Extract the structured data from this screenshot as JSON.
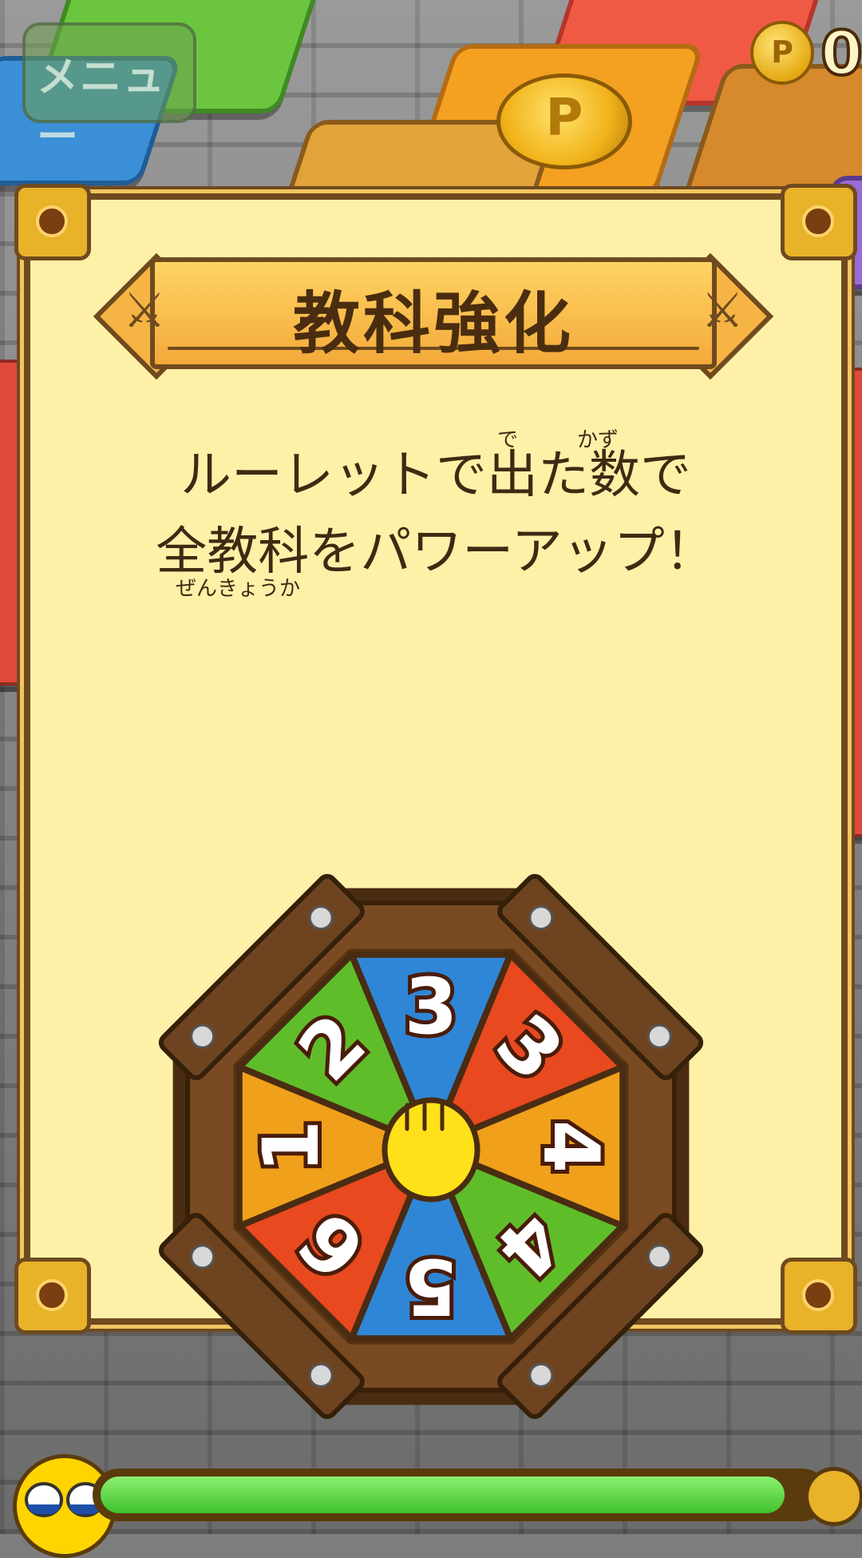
{
  "topbar": {
    "menu_label": "メニュー",
    "points_value": "0",
    "coin_icon_label": "P"
  },
  "board": {
    "big_coin_label": "P"
  },
  "dialog": {
    "title": "教科強化",
    "line1": "ルーレットで出た数で",
    "line2": "全教科をパワーアップ！",
    "ruby_de": "で",
    "ruby_kazu": "かず",
    "ruby_zenkyouka": "ぜんきょうか"
  },
  "roulette": {
    "segments": [
      {
        "number": "3",
        "color": "#2f86d6"
      },
      {
        "number": "3",
        "color": "#e8491f"
      },
      {
        "number": "4",
        "color": "#f0a01a"
      },
      {
        "number": "4",
        "color": "#5fbd2a"
      },
      {
        "number": "5",
        "color": "#2f86d6"
      },
      {
        "number": "6",
        "color": "#e8491f"
      },
      {
        "number": "1",
        "color": "#f0a01a"
      },
      {
        "number": "2",
        "color": "#5fbd2a"
      }
    ]
  },
  "status": {
    "hp_fraction": 0.95
  },
  "colors": {
    "panel_bg": "#fff0a8",
    "frame": "#6f4a1f",
    "bar_fill": "#3fc12c"
  }
}
